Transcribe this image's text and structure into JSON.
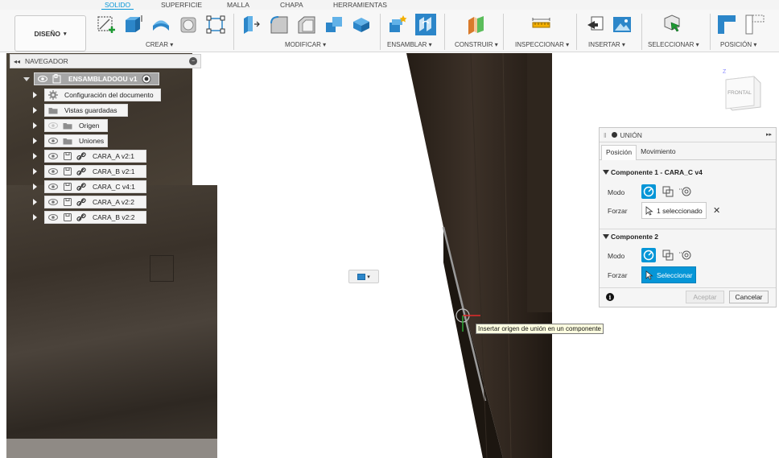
{
  "tabs": [
    {
      "label": "SOLIDO",
      "active": true
    },
    {
      "label": "SUPERFICIE",
      "active": false
    },
    {
      "label": "MALLA",
      "active": false
    },
    {
      "label": "CHAPA",
      "active": false
    },
    {
      "label": "HERRAMIENTAS",
      "active": false
    }
  ],
  "workspace": {
    "label": "DISEÑO",
    "caret": "▾"
  },
  "groups": {
    "crear": "CREAR ▾",
    "modificar": "MODIFICAR ▾",
    "ensamblar": "ENSAMBLAR ▾",
    "construir": "CONSTRUIR ▾",
    "inspeccionar": "INSPECCIONAR ▾",
    "insertar": "INSERTAR ▾",
    "seleccionar": "SELECCIONAR ▾",
    "posicion": "POSICIÓN ▾"
  },
  "browser": {
    "title": "NAVEGADOR",
    "collapse_glyph": "◂◂",
    "root": "ENSAMBLADOOU v1",
    "items": [
      {
        "label": "Configuración del documento",
        "icon": "gear-icon"
      },
      {
        "label": "Vistas guardadas",
        "icon": "folder-icon"
      },
      {
        "label": "Origen",
        "icon": "folder-icon"
      },
      {
        "label": "Uniones",
        "icon": "folder-icon"
      },
      {
        "label": "CARA_A v2:1",
        "icon": "component-link-icon"
      },
      {
        "label": "CARA_B v2:1",
        "icon": "component-link-icon"
      },
      {
        "label": "CARA_C v4:1",
        "icon": "component-link-icon"
      },
      {
        "label": "CARA_A v2:2",
        "icon": "component-link-icon"
      },
      {
        "label": "CARA_B v2:2",
        "icon": "component-link-icon"
      }
    ]
  },
  "viewcube": {
    "face": "FRONTAL",
    "axis": "Z"
  },
  "tooltip": "Insertar origen de unión en un componente",
  "mini_toolbar": {
    "caret": "▾"
  },
  "panel": {
    "title": "UNIÓN",
    "expand_glyph": "▸▸",
    "tabs": [
      "Posición",
      "Movimiento"
    ],
    "comp1": {
      "title": "Componente 1 - CARA_C v4",
      "mode_label": "Modo",
      "force_label": "Forzar",
      "selection": "1 seleccionado",
      "clear": "✕"
    },
    "comp2": {
      "title": "Componente 2",
      "mode_label": "Modo",
      "force_label": "Forzar",
      "selection": "Seleccionar"
    },
    "info": "i",
    "ok": "Aceptar",
    "cancel": "Cancelar"
  },
  "colors": {
    "accent": "#0696d7",
    "model_dark": "#2b231c"
  }
}
